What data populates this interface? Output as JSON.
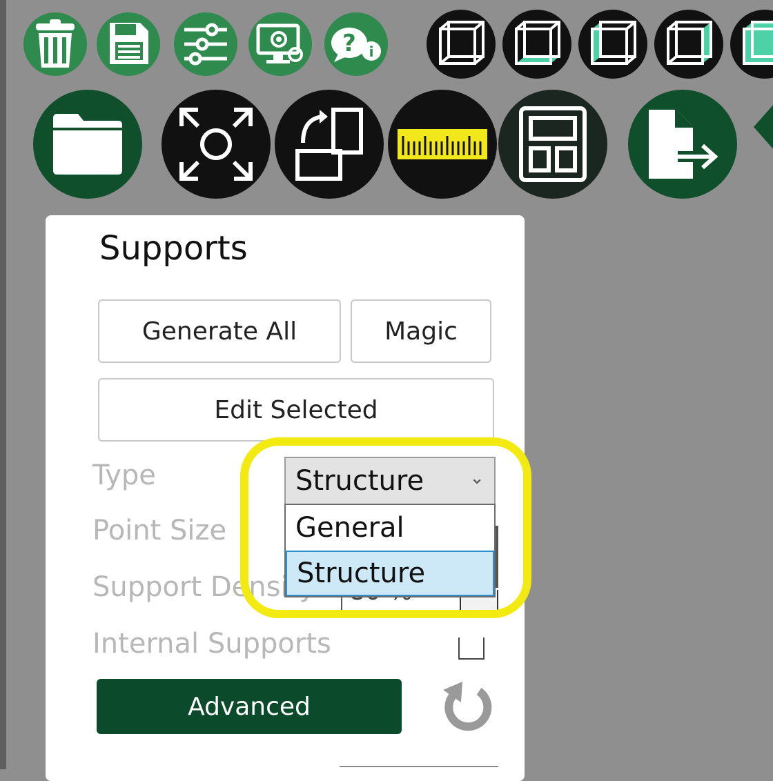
{
  "toolbar_row1": {
    "icons": [
      "trash-icon",
      "save-icon",
      "sliders-icon",
      "settings-monitor-icon",
      "help-info-icon",
      "cube-view-front-icon",
      "cube-view-bottom-icon",
      "cube-view-left-icon",
      "cube-view-right-icon",
      "cube-view-top-icon"
    ]
  },
  "toolbar_row2": {
    "icons": [
      "folder-icon",
      "fit-view-icon",
      "transform-icon",
      "ruler-icon",
      "layout-icon",
      "export-icon"
    ]
  },
  "supports_panel": {
    "title": "Supports",
    "generate_all_label": "Generate All",
    "magic_label": "Magic",
    "edit_selected_label": "Edit Selected",
    "type_label": "Type",
    "type_value": "Structure",
    "type_options": [
      "General",
      "Structure"
    ],
    "point_size_label": "Point Size",
    "support_density_label": "Support Density",
    "support_density_value": "80 %",
    "internal_supports_label": "Internal Supports",
    "advanced_label": "Advanced"
  },
  "colors": {
    "toolbar_green": "#2f8a4e",
    "dark_green": "#0c4a2c",
    "highlight_yellow": "#f3ea12",
    "viewport_gray": "#8f8f8f"
  }
}
